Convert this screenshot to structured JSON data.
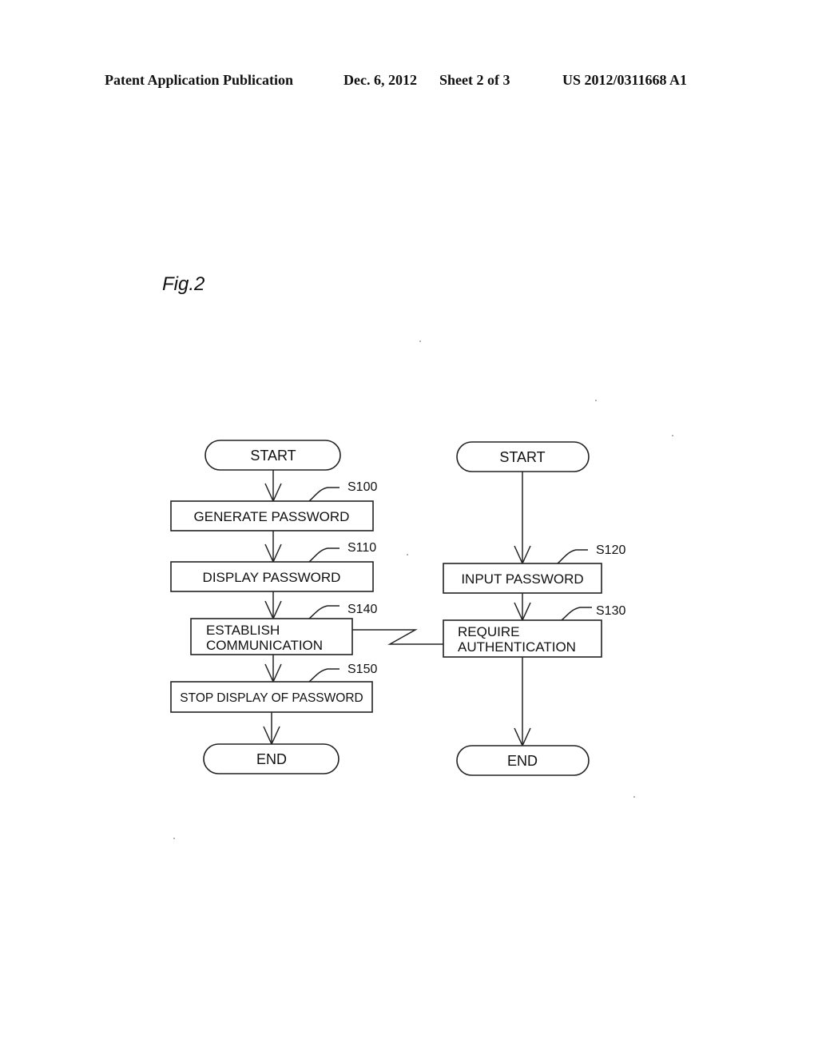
{
  "header": {
    "publication": "Patent Application Publication",
    "date": "Dec. 6, 2012",
    "sheet": "Sheet 2 of 3",
    "number": "US 2012/0311668 A1"
  },
  "figure": {
    "label": "Fig.2",
    "left_flow": {
      "start": "START",
      "steps": [
        {
          "id": "S100",
          "lines": [
            "GENERATE PASSWORD"
          ]
        },
        {
          "id": "S110",
          "lines": [
            "DISPLAY PASSWORD"
          ]
        },
        {
          "id": "S140",
          "lines": [
            "ESTABLISH",
            "COMMUNICATION"
          ]
        },
        {
          "id": "S150",
          "lines": [
            "STOP DISPLAY OF PASSWORD"
          ]
        }
      ],
      "end": "END"
    },
    "right_flow": {
      "start": "START",
      "steps": [
        {
          "id": "S120",
          "lines": [
            "INPUT PASSWORD"
          ]
        },
        {
          "id": "S130",
          "lines": [
            "REQUIRE",
            "AUTHENTICATION"
          ]
        }
      ],
      "end": "END"
    }
  }
}
